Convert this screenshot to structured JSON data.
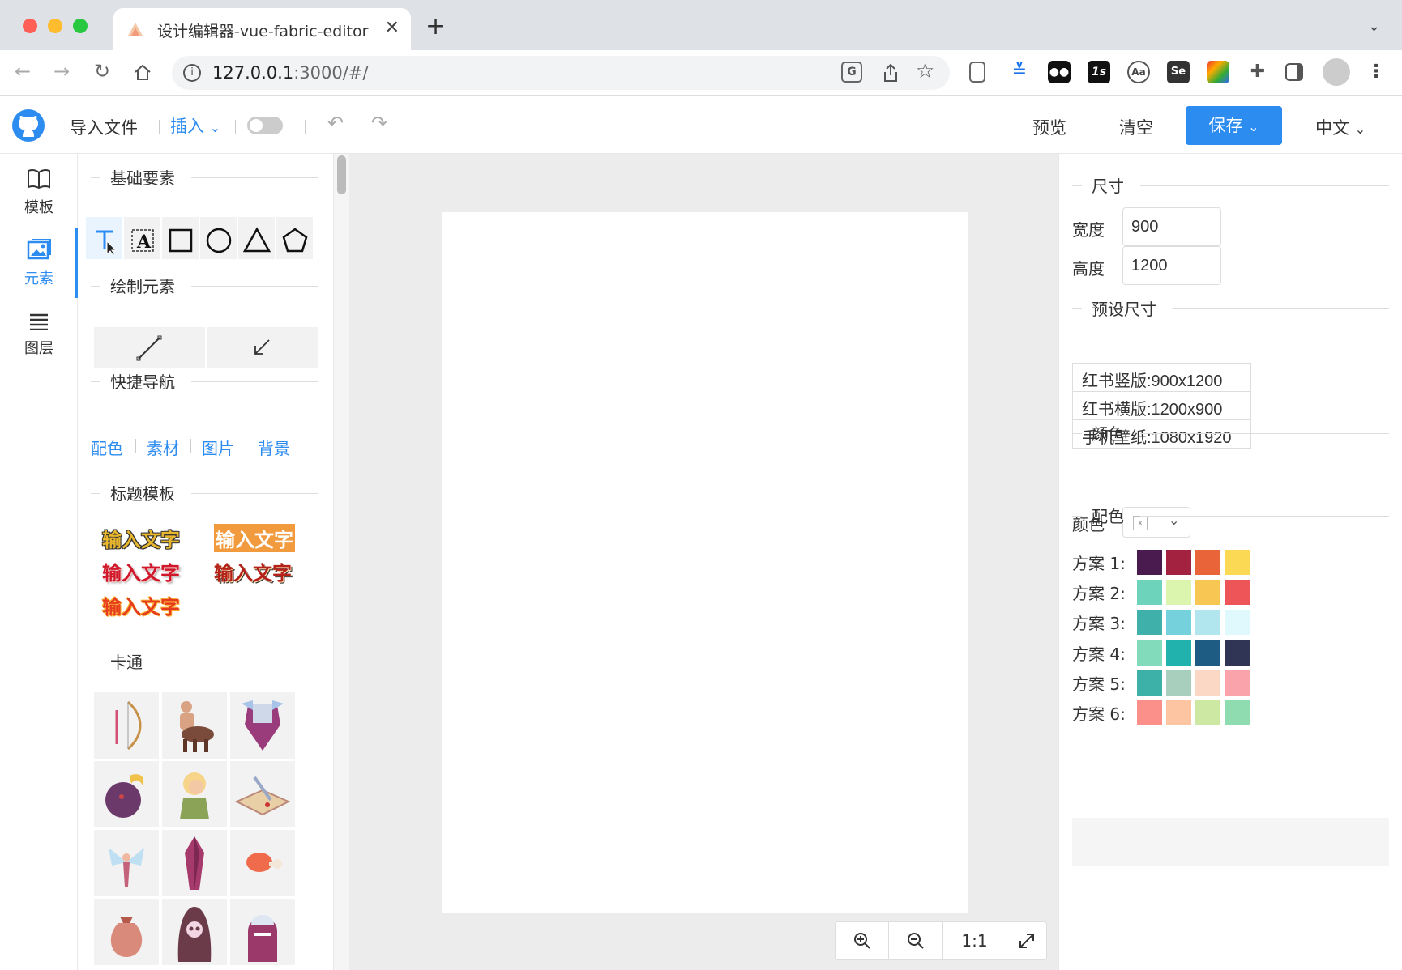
{
  "browser": {
    "tab_title": "设计编辑器-vue-fabric-editor",
    "tab_close": "✕",
    "new_tab": "+",
    "url_host": "127.0.0.1",
    "url_rest": ":3000/#/",
    "extensions": [
      "translate-icon",
      "share-icon",
      "star-icon",
      "reader-icon",
      "ext-arrow-icon",
      "ext-eyes-icon",
      "ext-1s-icon",
      "ext-aa-icon",
      "ext-se-icon",
      "ext-color-icon",
      "puzzle-icon",
      "sidepanel-icon",
      "profile-icon",
      "menu-icon"
    ]
  },
  "header": {
    "import": "导入文件",
    "insert": "插入",
    "preview": "预览",
    "clear": "清空",
    "save": "保存",
    "language": "中文"
  },
  "leftnav": {
    "items": [
      {
        "label": "模板",
        "icon": "book-icon"
      },
      {
        "label": "元素",
        "icon": "image-icon"
      },
      {
        "label": "图层",
        "icon": "layers-icon"
      }
    ]
  },
  "panel": {
    "basic_title": "基础要素",
    "draw_title": "绘制元素",
    "quicknav_title": "快捷导航",
    "quicknav": [
      "配色",
      "素材",
      "图片",
      "背景"
    ],
    "heading_title": "标题模板",
    "wordart": [
      "输入文字",
      "输入文字",
      "输入文字",
      "输入文字",
      "输入文字"
    ],
    "cartoon_title": "卡通",
    "cartoons": [
      "bow-icon",
      "centaur-icon",
      "armor-icon",
      "monster-icon",
      "elf-icon",
      "map-icon",
      "fairy-icon",
      "crystal-icon",
      "meat-icon",
      "bag-icon",
      "skull-hood-icon",
      "knight-icon"
    ]
  },
  "canvas": {
    "zoom_reset": "1:1"
  },
  "right": {
    "size_title": "尺寸",
    "width_label": "宽度",
    "width_value": "900",
    "height_label": "高度",
    "height_value": "1200",
    "preset_title": "预设尺寸",
    "presets": [
      "红书竖版:900x1200",
      "红书横版:1200x900",
      "手机壁纸:1080x1920"
    ],
    "color_title": "颜色",
    "color_label": "颜色",
    "palette_title": "配色",
    "schemes": [
      {
        "label": "方案 1:",
        "colors": [
          "#4a1b4e",
          "#a3223f",
          "#ea6439",
          "#fbd954"
        ]
      },
      {
        "label": "方案 2:",
        "colors": [
          "#6dd4bb",
          "#dcf5ae",
          "#f8c753",
          "#ed5558"
        ]
      },
      {
        "label": "方案 3:",
        "colors": [
          "#40b0aa",
          "#75d1dc",
          "#b1e6ee",
          "#dff9fd"
        ]
      },
      {
        "label": "方案 4:",
        "colors": [
          "#82dbbb",
          "#21b2ad",
          "#1f5c84",
          "#303556"
        ]
      },
      {
        "label": "方案 5:",
        "colors": [
          "#3db1a8",
          "#a8cfbe",
          "#fbd8c6",
          "#fba3aa"
        ]
      },
      {
        "label": "方案 6:",
        "colors": [
          "#fb8f8a",
          "#fdc5a1",
          "#cde8a2",
          "#8fdcb1"
        ]
      }
    ]
  },
  "colors": {
    "accent": "#2d8cf0"
  }
}
